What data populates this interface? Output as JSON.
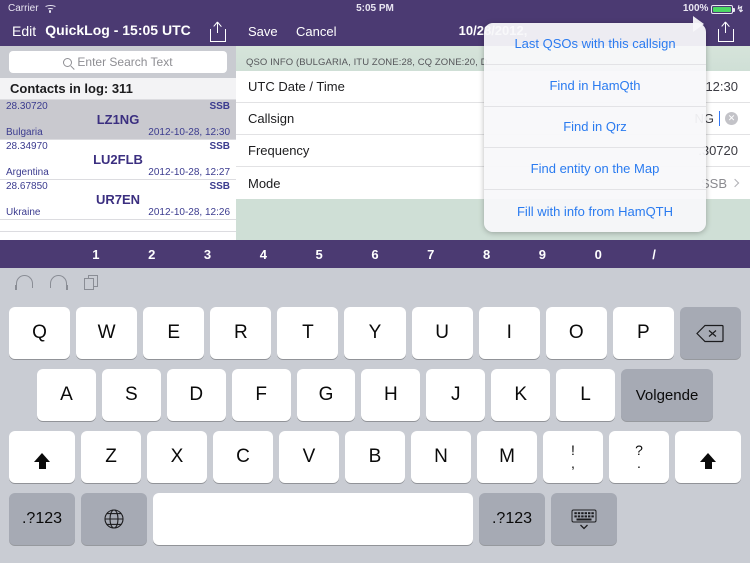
{
  "status_bar": {
    "carrier": "Carrier",
    "wifi_icon": "wifi-icon",
    "time": "5:05 PM",
    "battery_percent": "100%",
    "battery_icon": "battery-icon",
    "charging_icon": "plug-icon"
  },
  "left_navbar": {
    "edit_label": "Edit",
    "title": "QuickLog - 15:05 UTC",
    "share_icon": "share-icon"
  },
  "right_navbar": {
    "save_label": "Save",
    "cancel_label": "Cancel",
    "title": "10/28/2012,",
    "share_icon": "share-icon"
  },
  "search": {
    "placeholder": "Enter Search Text",
    "value": "",
    "icon": "search-icon"
  },
  "master": {
    "section_header": "Contacts in log: 311",
    "rows": [
      {
        "frequency": "28.30720",
        "mode": "SSB",
        "callsign": "LZ1NG",
        "country": "Bulgaria",
        "datetime": "2012-10-28, 12:30",
        "selected": true
      },
      {
        "frequency": "28.34970",
        "mode": "SSB",
        "callsign": "LU2FLB",
        "country": "Argentina",
        "datetime": "2012-10-28, 12:27",
        "selected": false
      },
      {
        "frequency": "28.67850",
        "mode": "SSB",
        "callsign": "UR7EN",
        "country": "Ukraine",
        "datetime": "2012-10-28, 12:26",
        "selected": false
      }
    ]
  },
  "detail": {
    "section_header": "QSO INFO (BULGARIA, ITU ZONE:28, CQ ZONE:20, D",
    "fields": [
      {
        "label": "UTC Date / Time",
        "value": "12:30",
        "accessory": "none"
      },
      {
        "label": "Callsign",
        "value": "NG",
        "accessory": "clear"
      },
      {
        "label": "Frequency",
        "value": ".30720",
        "accessory": "none"
      },
      {
        "label": "Mode",
        "value": "SSB",
        "accessory": "chevron"
      }
    ]
  },
  "popover": {
    "items": [
      "Last QSOs with this callsign",
      "Find in HamQth",
      "Find in Qrz",
      "Find entity on the Map",
      "Fill with info from HamQTH"
    ]
  },
  "number_bar": {
    "keys": [
      "1",
      "2",
      "3",
      "4",
      "5",
      "6",
      "7",
      "8",
      "9",
      "0",
      "/"
    ]
  },
  "keyboard": {
    "tools": [
      "undo-icon",
      "redo-icon",
      "copy-icon"
    ],
    "row1": [
      "Q",
      "W",
      "E",
      "R",
      "T",
      "Y",
      "U",
      "I",
      "O",
      "P"
    ],
    "row1_special": {
      "label": "delete-icon"
    },
    "row2": [
      "A",
      "S",
      "D",
      "F",
      "G",
      "H",
      "J",
      "K",
      "L"
    ],
    "row2_special": {
      "label": "Volgende"
    },
    "row3_left_shift": "shift-icon",
    "row3": [
      "Z",
      "X",
      "C",
      "V",
      "B",
      "N",
      "M"
    ],
    "row3_punct": [
      {
        "top": "!",
        "bottom": ","
      },
      {
        "top": "?",
        "bottom": "."
      }
    ],
    "row3_right_shift": "shift-icon",
    "row4": {
      "numbers_left": ".?123",
      "globe": "globe-icon",
      "space": "",
      "numbers_right": ".?123",
      "hide": "hide-keyboard-icon"
    }
  },
  "colors": {
    "nav_purple": "#4b3a72",
    "link_blue": "#2a7bf0",
    "detail_green": "#cfdfd6",
    "keyboard_gray": "#c9ccd3",
    "battery_green": "#4cd964"
  }
}
